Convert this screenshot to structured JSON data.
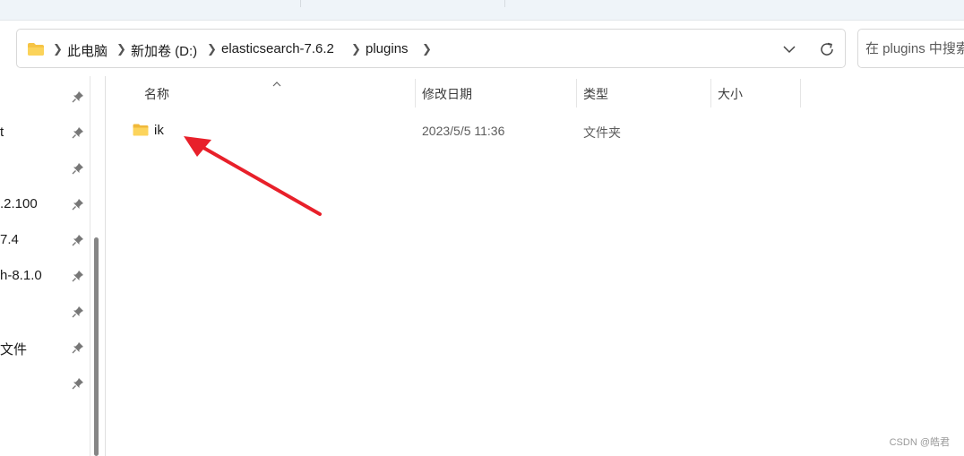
{
  "address_bar": {
    "breadcrumbs": [
      "此电脑",
      "新加卷 (D:)",
      "elasticsearch-7.6.2",
      "plugins"
    ]
  },
  "search": {
    "placeholder": "在 plugins 中搜索"
  },
  "nav_pane": {
    "items": [
      {
        "label": ""
      },
      {
        "label": "t"
      },
      {
        "label": ""
      },
      {
        "label": ".2.100"
      },
      {
        "label": "7.4"
      },
      {
        "label": "h-8.1.0"
      },
      {
        "label": ""
      },
      {
        "label": "文件"
      },
      {
        "label": ""
      }
    ]
  },
  "columns": [
    "名称",
    "修改日期",
    "类型",
    "大小"
  ],
  "files": [
    {
      "name": "ik",
      "modified": "2023/5/5 11:36",
      "type": "文件夹",
      "size": "",
      "icon": "folder-icon"
    }
  ],
  "annotation": {
    "color": "#e8202a"
  },
  "watermark": "CSDN @皓君",
  "colors": {
    "folder": "#f6c445",
    "accent": "#0067c0"
  }
}
